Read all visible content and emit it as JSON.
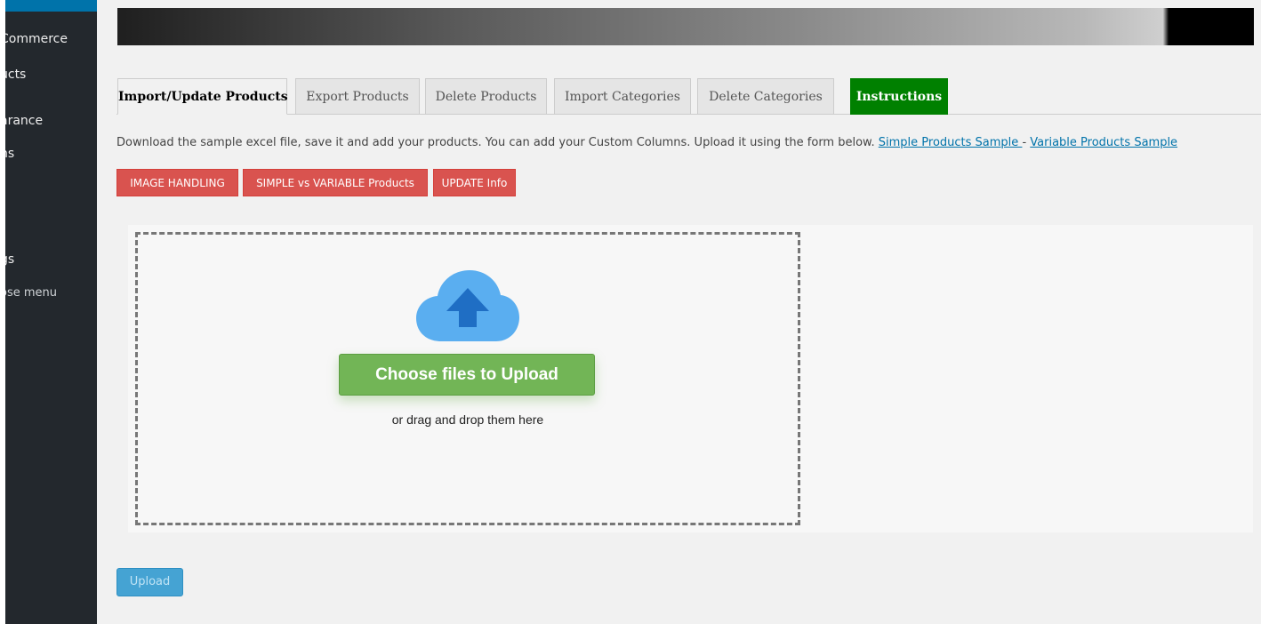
{
  "sidebar": {
    "items": [
      {
        "label": "Commerce"
      },
      {
        "label": "ucts"
      },
      {
        "label": "arance"
      },
      {
        "label": "ns"
      },
      {
        "label": "gs"
      },
      {
        "label": "ose menu"
      }
    ]
  },
  "tabs": [
    {
      "label": "Import/Update Products",
      "state": "active"
    },
    {
      "label": "Export Products"
    },
    {
      "label": "Delete Products"
    },
    {
      "label": "Import Categories"
    },
    {
      "label": "Delete Categories"
    },
    {
      "label": "Instructions",
      "color": "#008000"
    }
  ],
  "description": {
    "text": "Download the sample excel file, save it and add your products. You can add your Custom Columns. Upload it using the form below.",
    "simple_link": "Simple Products Sample ",
    "separator": "-",
    "variable_link": "Variable Products Sample"
  },
  "info_buttons": [
    {
      "label": "IMAGE HANDLING"
    },
    {
      "label": "SIMPLE vs VARIABLE Products"
    },
    {
      "label": "UPDATE Info"
    }
  ],
  "dropzone": {
    "icon": "cloud-upload-icon",
    "choose_label": "Choose files to Upload",
    "drag_text": "or drag and drop them here"
  },
  "upload_label": "Upload",
  "colors": {
    "sidebar": "#23282d",
    "tab_instructions": "#008000",
    "info_button": "#d9534f",
    "choose_button": "#72b556",
    "upload_button": "#45a3d3",
    "link": "#0073aa"
  }
}
